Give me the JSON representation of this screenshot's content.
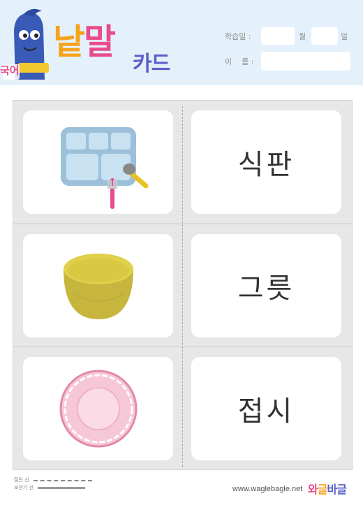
{
  "header": {
    "title_part1": "낱",
    "title_part2": "말",
    "title_small": "카드",
    "mascot_text": "국어",
    "date_label": "학습일 :",
    "month_label": "월",
    "day_label": "일",
    "name_label": "이    름 :"
  },
  "cards": [
    {
      "picture": "tray-icon",
      "word": "식판"
    },
    {
      "picture": "bowl-icon",
      "word": "그릇"
    },
    {
      "picture": "plate-icon",
      "word": "접시"
    }
  ],
  "footer": {
    "cut_line_label": "절단 선",
    "fold_line_label": "보관기 선",
    "site": "www.waglebagle.net",
    "brand_part1": "와",
    "brand_part2": "글",
    "brand_part3": "바글"
  },
  "colors": {
    "header_bg": "#e4f1fb",
    "title_orange": "#f7a21b",
    "title_pink": "#e84c8b",
    "title_purple": "#5a5fc8"
  }
}
